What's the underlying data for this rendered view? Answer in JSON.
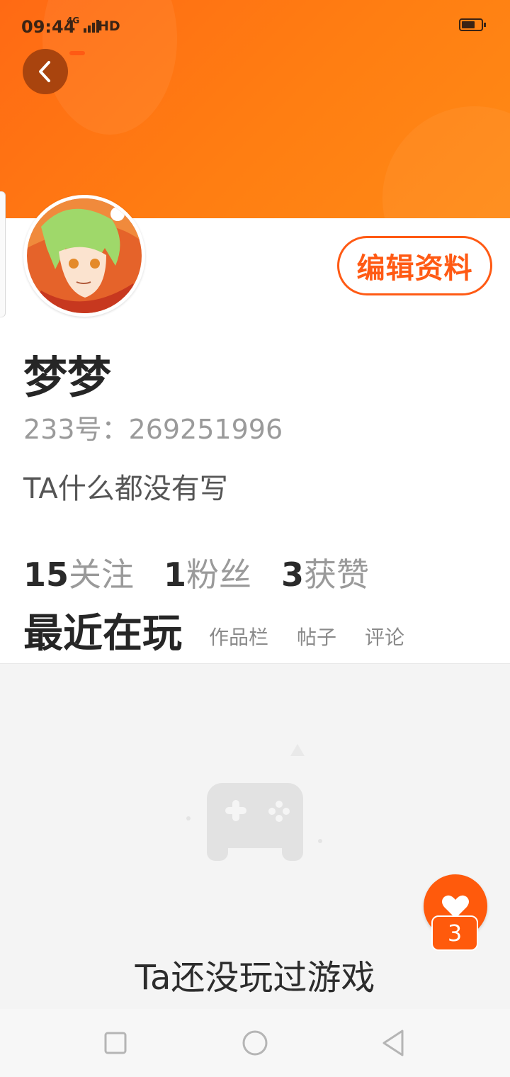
{
  "status_bar": {
    "time": "09:44",
    "network": "4G",
    "hd_label": "HD"
  },
  "profile": {
    "name": "梦梦",
    "id_text": "233号：269251996",
    "bio": "TA什么都没有写",
    "edit_button_label": "编辑资料"
  },
  "stats": [
    {
      "value": "15",
      "label": "关注"
    },
    {
      "value": "1",
      "label": "粉丝"
    },
    {
      "value": "3",
      "label": "获赞"
    }
  ],
  "tabs": {
    "active": "最近在玩",
    "others": [
      "作品栏",
      "帖子",
      "评论"
    ]
  },
  "empty_state": {
    "text": "Ta还没玩过游戏"
  },
  "like_fab": {
    "count": "3"
  },
  "colors": {
    "accent": "#ff5a14",
    "header_gradient_start": "#ff6a14",
    "header_gradient_end": "#ff8a16",
    "back_button_bg": "#a9440e"
  },
  "icons": {
    "back": "chevron-left-icon",
    "like": "heart-icon",
    "game": "gamepad-icon",
    "nav_recent": "square-icon",
    "nav_home": "circle-icon",
    "nav_back": "triangle-back-icon"
  }
}
